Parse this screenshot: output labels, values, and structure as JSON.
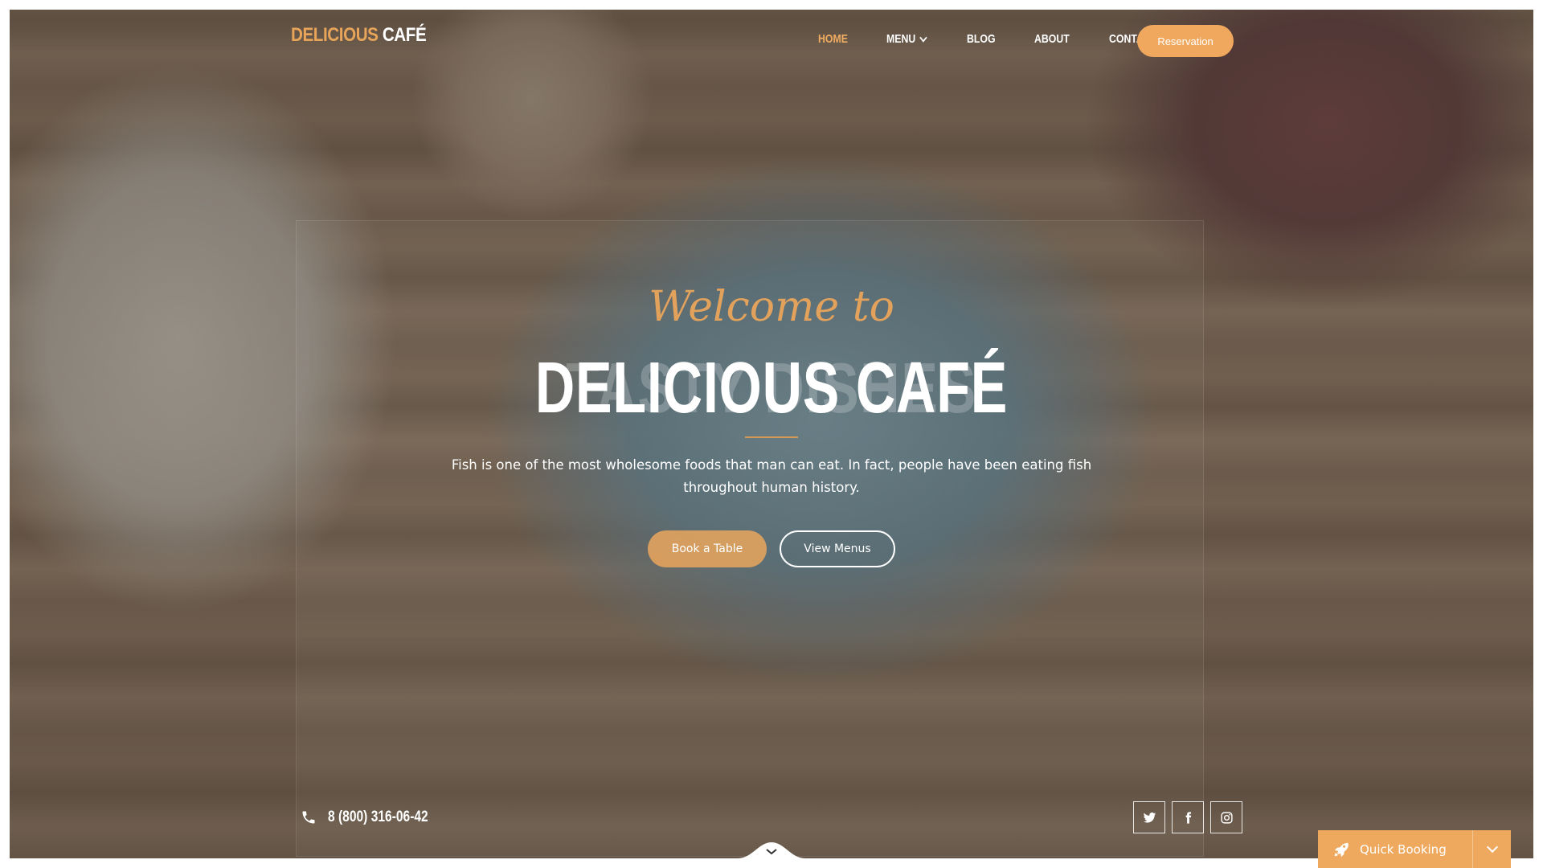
{
  "brand": {
    "part1": "DELICIOUS",
    "part2": "CAFÉ"
  },
  "nav": {
    "items": [
      {
        "label": "HOME",
        "active": true
      },
      {
        "label": "MENU",
        "has_dropdown": true
      },
      {
        "label": "BLOG"
      },
      {
        "label": "ABOUT"
      },
      {
        "label": "CONTACT"
      }
    ],
    "reservation_label": "Reservation"
  },
  "hero": {
    "welcome": "Welcome to",
    "background_text": "TASTY DISHES",
    "title": "DELICIOUS CAFÉ",
    "description": "Fish is one of the most wholesome foods that man can eat. In fact, people have been eating fish throughout human history.",
    "book_label": "Book a Table",
    "view_label": "View Menus"
  },
  "contact": {
    "phone": "8 (800) 316-06-42",
    "phone_icon": "phone-icon"
  },
  "socials": [
    {
      "name": "twitter-icon"
    },
    {
      "name": "facebook-icon"
    },
    {
      "name": "instagram-icon"
    }
  ],
  "booking": {
    "label": "Quick Booking",
    "icon": "rocket-icon"
  },
  "colors": {
    "accent": "#efa85d",
    "accent_text": "#e2a25c",
    "text": "#ffffff"
  }
}
